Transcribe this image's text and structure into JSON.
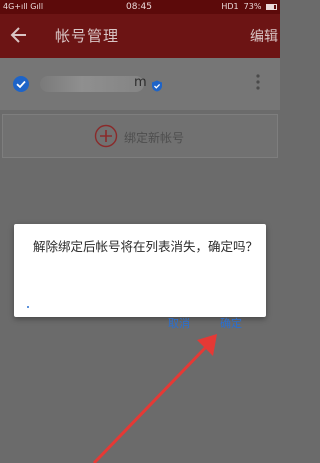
{
  "status_bar": {
    "left_text": "4G+ıll Gıll",
    "time": "08:45",
    "right_text": "HD1 ⁠ 73%",
    "battery_level": 0.73
  },
  "header": {
    "back_icon": "arrow-left-icon",
    "title": "帐号管理",
    "edit_label": "编辑"
  },
  "account": {
    "name_suffix": "m",
    "check_icon": "checkmark-circle-icon",
    "verified_icon": "verified-shield-icon",
    "more_icon": "more-vertical-icon"
  },
  "bind_new": {
    "icon": "plus-circle-icon",
    "label": "绑定新帐号"
  },
  "dialog": {
    "message": "解除绑定后帐号将在列表消失，确定吗？",
    "cancel_label": "取消",
    "confirm_label": "确定"
  },
  "colors": {
    "header_bg": "#6c1414",
    "status_bg": "#5c0a0a",
    "accent_blue": "#2a6fd0",
    "annotation_arrow": "#e53935",
    "overlay_gray": "#6b6b6b"
  }
}
